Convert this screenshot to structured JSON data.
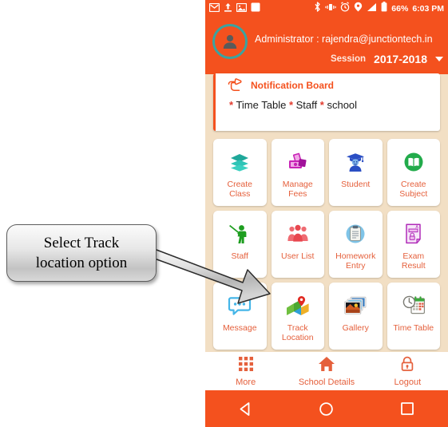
{
  "annotation": {
    "callout_text_line1": "Select Track",
    "callout_text_line2": "location option",
    "arrow_name": "pointer-arrow"
  },
  "status_bar": {
    "icons": [
      "gmail-icon",
      "upload-icon",
      "screenshot-icon",
      "app-icon",
      "bluetooth-icon",
      "vibrate-icon",
      "alarm-icon",
      "location-icon",
      "signal-icon",
      "battery-icon"
    ],
    "battery_percent": "66%",
    "time": "6:03 PM"
  },
  "header": {
    "admin_label": "Administrator : rajendra@junctiontech.in",
    "session_label": "Session",
    "session_value": "2017-2018",
    "avatar_name": "user-avatar",
    "accent_color": "#f4511e",
    "avatar_ring_color": "#3aa3a0"
  },
  "notification": {
    "title": "Notification Board",
    "body_prefix": "*",
    "items": [
      "Time Table",
      "Staff",
      "school"
    ],
    "body_text": "* Time Table * Staff * school",
    "icon": "pointing-hand-icon"
  },
  "grid": {
    "tiles": [
      {
        "label": "Create\nClass",
        "label_line1": "Create",
        "label_line2": "Class",
        "icon": "layers-icon"
      },
      {
        "label": "Manage\nFees",
        "label_line1": "Manage",
        "label_line2": "Fees",
        "icon": "money-icon"
      },
      {
        "label": "Student",
        "label_line1": "Student",
        "label_line2": "",
        "icon": "graduate-icon"
      },
      {
        "label": "Create\nSubject",
        "label_line1": "Create",
        "label_line2": "Subject",
        "icon": "book-icon"
      },
      {
        "label": "Staff",
        "label_line1": "Staff",
        "label_line2": "",
        "icon": "teacher-icon"
      },
      {
        "label": "User List",
        "label_line1": "User List",
        "label_line2": "",
        "icon": "people-icon"
      },
      {
        "label": "Homework\nEntry",
        "label_line1": "Homework",
        "label_line2": "Entry",
        "icon": "clipboard-icon"
      },
      {
        "label": "Exam\nResult",
        "label_line1": "Exam",
        "label_line2": "Result",
        "icon": "report-card-icon"
      },
      {
        "label": "Message",
        "label_line1": "Message",
        "label_line2": "",
        "icon": "chat-bubble-icon"
      },
      {
        "label": "Track\nLocation",
        "label_line1": "Track",
        "label_line2": "Location",
        "icon": "map-pin-icon"
      },
      {
        "label": "Gallery",
        "label_line1": "Gallery",
        "label_line2": "",
        "icon": "photos-icon"
      },
      {
        "label": "Time Table",
        "label_line1": "Time Table",
        "label_line2": "",
        "icon": "calendar-clock-icon"
      }
    ],
    "label_color": "#e5603c",
    "background_color": "#f2dfc4"
  },
  "bottom_nav": {
    "items": [
      {
        "label": "More",
        "icon": "grid-dots-icon"
      },
      {
        "label": "School Details",
        "icon": "home-icon"
      },
      {
        "label": "Logout",
        "icon": "lock-icon"
      }
    ]
  },
  "android_nav": {
    "back": "back-triangle-icon",
    "home": "home-circle-icon",
    "recents": "recents-square-icon"
  }
}
